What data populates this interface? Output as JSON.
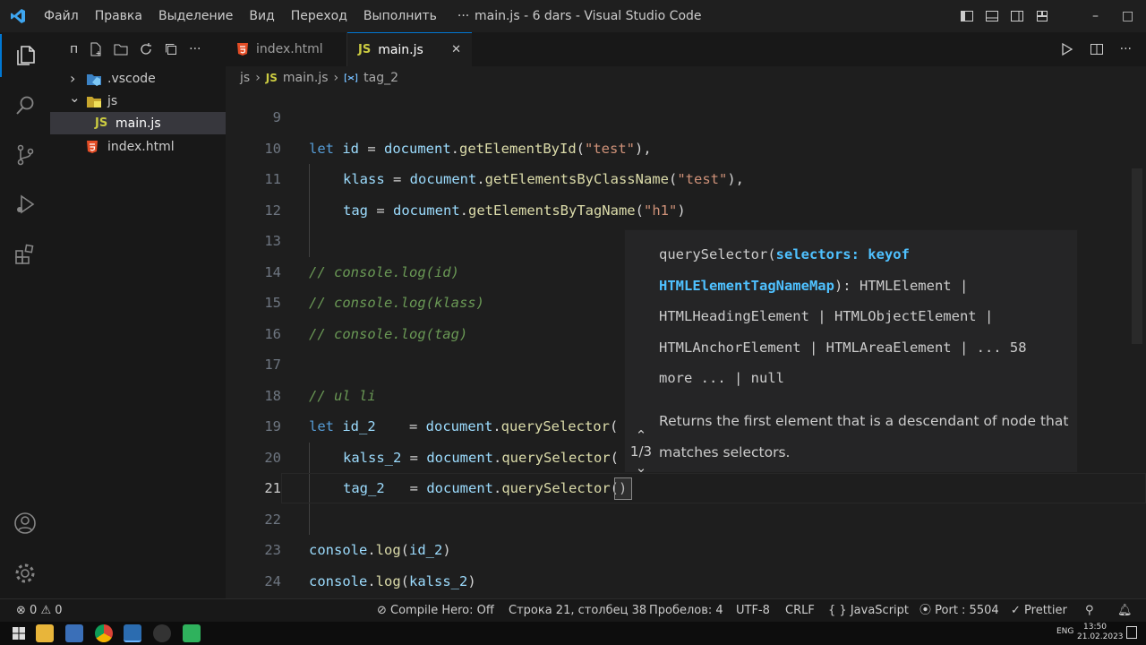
{
  "titlebar": {
    "menu": [
      "Файл",
      "Правка",
      "Выделение",
      "Вид",
      "Переход",
      "Выполнить"
    ],
    "overflow": "···",
    "window_title": "main.js - 6 dars - Visual Studio Code",
    "minimize": "–",
    "maximize": "□"
  },
  "sidebar": {
    "header": "п",
    "items": [
      {
        "label": ".vscode",
        "chevron": "›"
      },
      {
        "label": "js",
        "chevron": "⌄"
      },
      {
        "label": "main.js",
        "icon": "JS"
      },
      {
        "label": "index.html"
      }
    ]
  },
  "tabs": [
    {
      "label": "index.html"
    },
    {
      "label": "main.js",
      "icon": "JS",
      "close": "✕"
    }
  ],
  "breadcrumb": [
    "js",
    "main.js",
    "tag_2"
  ],
  "breadcrumb_sep": "›",
  "breadcrumb_js_icon": "JS",
  "editor": {
    "line_numbers": [
      "9",
      "10",
      "11",
      "12",
      "13",
      "14",
      "15",
      "16",
      "17",
      "18",
      "19",
      "20",
      "21",
      "22",
      "23",
      "24"
    ],
    "lines": [
      [],
      [
        [
          "kw",
          "let "
        ],
        [
          "var",
          "id"
        ],
        [
          "pl",
          " = "
        ],
        [
          "var",
          "document"
        ],
        [
          "pl",
          "."
        ],
        [
          "fn",
          "getElementById"
        ],
        [
          "pl",
          "("
        ],
        [
          "str",
          "\"test\""
        ],
        [
          "pl",
          "),"
        ]
      ],
      [
        [
          "var",
          "klass"
        ],
        [
          "pl",
          " = "
        ],
        [
          "var",
          "document"
        ],
        [
          "pl",
          "."
        ],
        [
          "fn",
          "getElementsByClassName"
        ],
        [
          "pl",
          "("
        ],
        [
          "str",
          "\"test\""
        ],
        [
          "pl",
          "),"
        ]
      ],
      [
        [
          "var",
          "tag"
        ],
        [
          "pl",
          " = "
        ],
        [
          "var",
          "document"
        ],
        [
          "pl",
          "."
        ],
        [
          "fn",
          "getElementsByTagName"
        ],
        [
          "pl",
          "("
        ],
        [
          "str",
          "\"h1\""
        ],
        [
          "pl",
          ")"
        ]
      ],
      [],
      [
        [
          "cm",
          "// console.log(id)"
        ]
      ],
      [
        [
          "cm",
          "// console.log(klass)"
        ]
      ],
      [
        [
          "cm",
          "// console.log(tag)"
        ]
      ],
      [],
      [
        [
          "cm",
          "// ul li"
        ]
      ],
      [
        [
          "kw",
          "let "
        ],
        [
          "var",
          "id_2"
        ],
        [
          "pl",
          "    = "
        ],
        [
          "var",
          "document"
        ],
        [
          "pl",
          "."
        ],
        [
          "fn",
          "querySelector"
        ],
        [
          "pl",
          "("
        ]
      ],
      [
        [
          "var",
          "kalss_2"
        ],
        [
          "pl",
          " = "
        ],
        [
          "var",
          "document"
        ],
        [
          "pl",
          "."
        ],
        [
          "fn",
          "querySelector"
        ],
        [
          "pl",
          "("
        ]
      ],
      [
        [
          "var",
          "tag_2"
        ],
        [
          "pl",
          "   = "
        ],
        [
          "var",
          "document"
        ],
        [
          "pl",
          "."
        ],
        [
          "fn",
          "querySelector"
        ],
        [
          "pl",
          "()"
        ]
      ],
      [],
      [
        [
          "var",
          "console"
        ],
        [
          "pl",
          "."
        ],
        [
          "fn",
          "log"
        ],
        [
          "pl",
          "("
        ],
        [
          "var",
          "id_2"
        ],
        [
          "pl",
          ")"
        ]
      ],
      [
        [
          "var",
          "console"
        ],
        [
          "pl",
          "."
        ],
        [
          "fn",
          "log"
        ],
        [
          "pl",
          "("
        ],
        [
          "var",
          "kalss_2"
        ],
        [
          "pl",
          ")"
        ]
      ]
    ]
  },
  "hover": {
    "sig_lines": [
      [
        [
          "n",
          "querySelector("
        ],
        [
          "b",
          "selectors: keyof"
        ]
      ],
      [
        [
          "b",
          "HTMLElementTagNameMap"
        ],
        [
          "n",
          "): HTMLElement |"
        ]
      ],
      [
        [
          "n",
          "HTMLHeadingElement | HTMLObjectElement |"
        ]
      ],
      [
        [
          "n",
          "HTMLAnchorElement | HTMLAreaElement | ... 58"
        ]
      ],
      [
        [
          "n",
          "more ... | null"
        ]
      ]
    ],
    "doc": "Returns the first element that is a descendant of node that matches selectors.",
    "counter": "1/3"
  },
  "status": {
    "errors": "0",
    "warnings": "0",
    "compile_hero": "Compile Hero: Off",
    "position": "Строка 21, столбец 38",
    "spaces": "Пробелов: 4",
    "encoding": "UTF-8",
    "eol": "CRLF",
    "language_brace": "{ }",
    "language": "JavaScript",
    "port": "Port : 5504",
    "prettier": "Prettier"
  },
  "taskbar": {
    "time": "13:50",
    "date": "21.02.2023",
    "lang": "ENG"
  },
  "colors": {
    "accent": "#0078d4",
    "keyword": "#569cd6",
    "function": "#dcdcaa",
    "string": "#ce9178",
    "comment": "#6a9955",
    "variable": "#9cdcfe"
  }
}
